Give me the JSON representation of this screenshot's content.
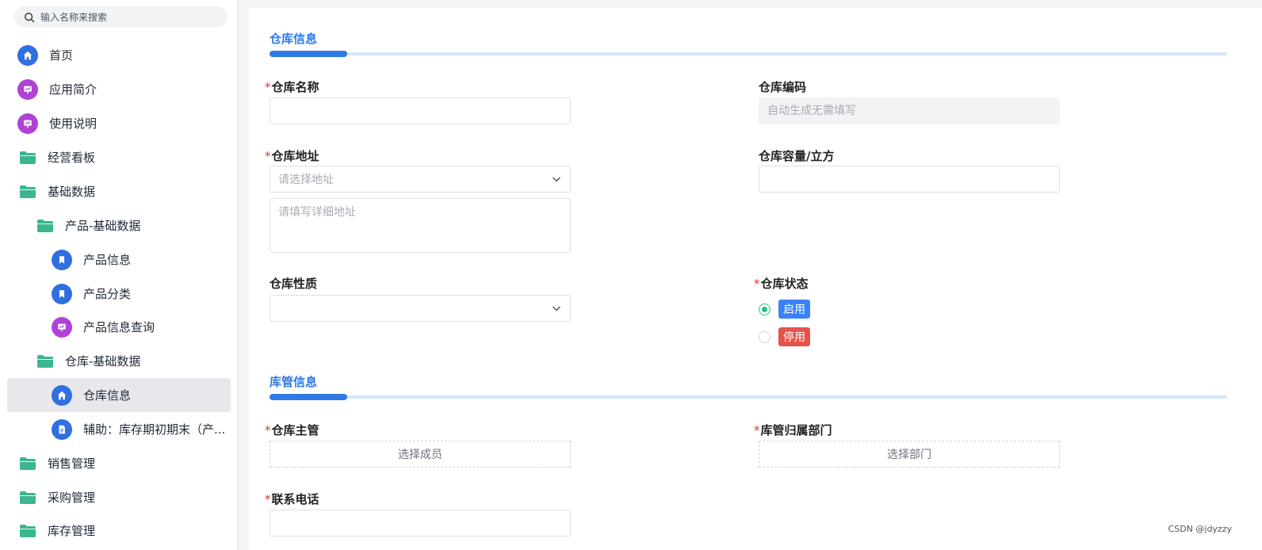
{
  "search": {
    "placeholder": "输入名称来搜索"
  },
  "sidebar": {
    "items": [
      {
        "label": "首页"
      },
      {
        "label": "应用简介"
      },
      {
        "label": "使用说明"
      },
      {
        "label": "经营看板"
      },
      {
        "label": "基础数据"
      },
      {
        "label": "产品-基础数据"
      },
      {
        "label": "产品信息"
      },
      {
        "label": "产品分类"
      },
      {
        "label": "产品信息查询"
      },
      {
        "label": "仓库-基础数据"
      },
      {
        "label": "仓库信息"
      },
      {
        "label": "辅助：库存期初期末（产..."
      },
      {
        "label": "销售管理"
      },
      {
        "label": "采购管理"
      },
      {
        "label": "库存管理"
      }
    ]
  },
  "form": {
    "section1_title": "仓库信息",
    "section2_title": "库管信息",
    "required_mark": "*",
    "warehouse_name": {
      "label": "仓库名称",
      "value": ""
    },
    "warehouse_code": {
      "label": "仓库编码",
      "placeholder": "自动生成无需填写"
    },
    "warehouse_address": {
      "label": "仓库地址",
      "select_placeholder": "请选择地址",
      "detail_placeholder": "请填写详细地址"
    },
    "warehouse_capacity": {
      "label": "仓库容量/立方",
      "value": ""
    },
    "warehouse_nature": {
      "label": "仓库性质",
      "value": ""
    },
    "warehouse_status": {
      "label": "仓库状态",
      "options": [
        {
          "label": "启用",
          "color": "#3b82f6",
          "checked": true
        },
        {
          "label": "停用",
          "color": "#e5534b",
          "checked": false
        }
      ]
    },
    "warehouse_manager": {
      "label": "仓库主管",
      "button": "选择成员"
    },
    "manager_department": {
      "label": "库管归属部门",
      "button": "选择部门"
    },
    "contact_phone": {
      "label": "联系电话",
      "value": ""
    }
  },
  "watermark": "CSDN @jdyzzy",
  "colors": {
    "accent": "#2f7be6",
    "home_icon": "#2f6fe0",
    "purple_icon": "#b043d6",
    "folder_icon": "#3cb591"
  }
}
